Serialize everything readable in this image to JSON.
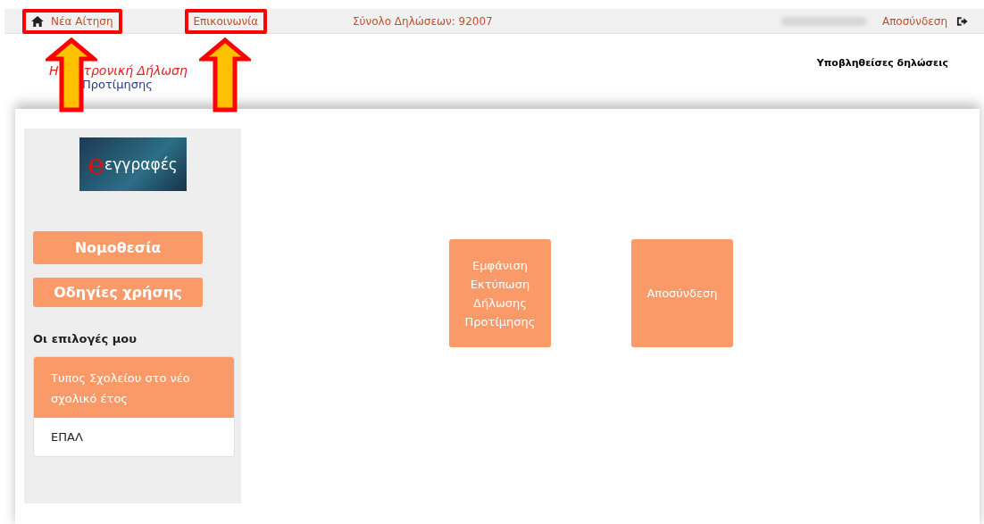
{
  "top_bar": {
    "links": [
      {
        "label": "Νέα Αίτηση",
        "highlighted": true
      },
      {
        "label": "Επικοινωνία",
        "highlighted": true
      }
    ],
    "total": "Σύνολο Δηλώσεων: 92007",
    "logout": "Αποσύνδεση"
  },
  "logo": {
    "line_1_start": "Η",
    "line_1_end": "τρονική Δήλωση",
    "line_2": "Προτίμησης"
  },
  "header_link": "Υποβληθείσες δηλώσεις",
  "sidebar": {
    "banner_letter": "e",
    "banner_text": "εγγραφές",
    "buttons": [
      "Νομοθεσία",
      "Οδηγίες χρήσης"
    ],
    "section_title": "Οι επιλογές μου",
    "choice": {
      "title": "Τυπος Σχολείου στο νέο σχολικό έτος",
      "value": "ΕΠΑΛ"
    }
  },
  "tiles": [
    "Εμφάνιση Εκτύπωση Δήλωσης Προτίμησης",
    "Αποσύνδεση"
  ]
}
